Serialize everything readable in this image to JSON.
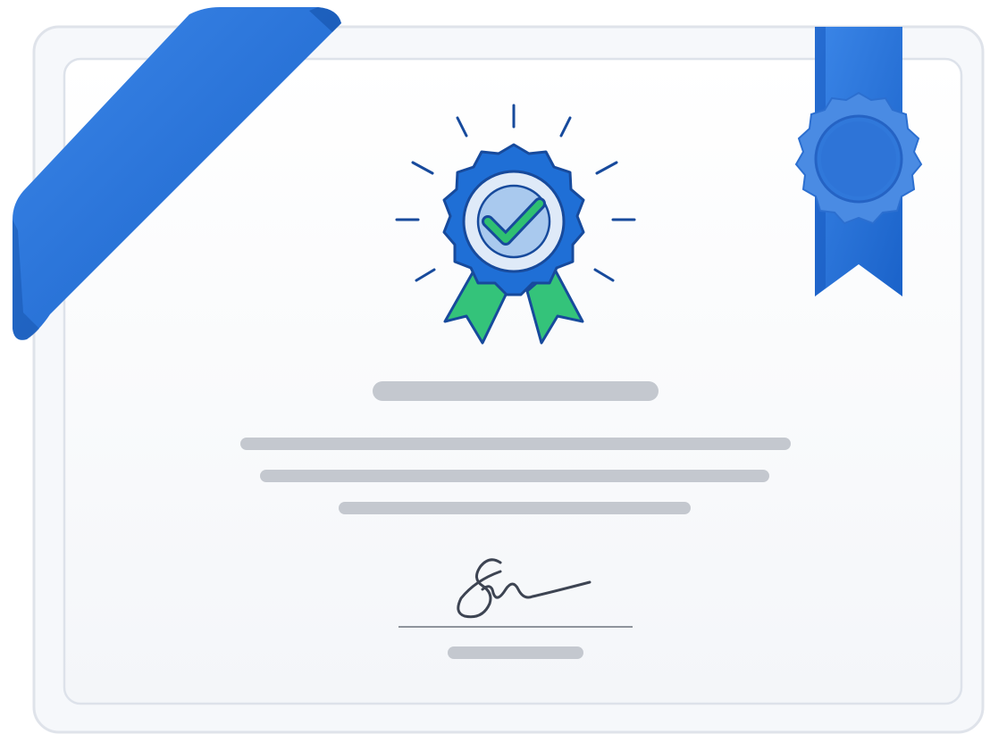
{
  "illustration": {
    "kind": "certificate",
    "signature": "handwritten",
    "colors": {
      "primary_blue": "#1f6fd6",
      "light_blue": "#4b8ee6",
      "ribbon_green": "#2fbf71",
      "check_green": "#2fbf71",
      "text_placeholder": "#c7cad0",
      "frame": "#e3e7ee",
      "card": "#ffffff"
    },
    "icons": [
      "award-badge-icon",
      "check-icon",
      "seal-icon",
      "corner-ribbon",
      "hanging-ribbon"
    ]
  }
}
